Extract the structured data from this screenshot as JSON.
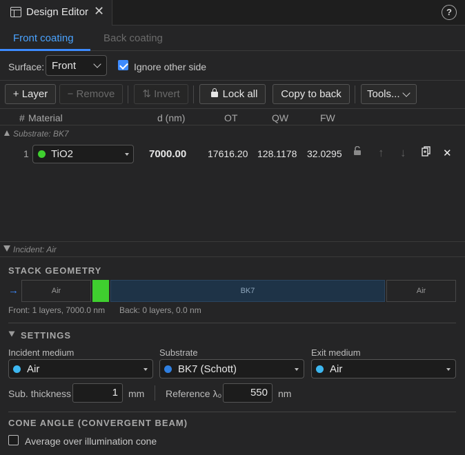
{
  "window": {
    "tab_title": "Design Editor",
    "help_label": "?"
  },
  "coating_tabs": [
    {
      "label": "Front coating"
    },
    {
      "label": "Back coating"
    }
  ],
  "surface": {
    "label": "Surface:",
    "value": "Front",
    "ignore_other_side": {
      "label": "Ignore other side",
      "checked": true
    }
  },
  "toolbar": {
    "add_layer": "+ Layer",
    "remove": "− Remove",
    "invert": "⇅ Invert",
    "lock_all": "Lock all",
    "copy_to_back": "Copy to back",
    "tools": "Tools..."
  },
  "table": {
    "headers": {
      "num": "#",
      "material": "Material",
      "d": "d (nm)",
      "ot": "OT",
      "qw": "QW",
      "fw": "FW"
    },
    "substrate_label": "Substrate: BK7",
    "incident_label": "Incident: Air",
    "rows": [
      {
        "num": "1",
        "material": "TiO2",
        "material_color": "#3fcf2f",
        "d": "7000.00",
        "ot": "17616.20",
        "qw": "128.1178",
        "fw": "32.0295"
      }
    ]
  },
  "stack_geometry": {
    "title": "STACK GEOMETRY",
    "segments": {
      "left_medium": "Air",
      "substrate": "BK7",
      "right_medium": "Air"
    },
    "layer_color": "#3fcf2f",
    "front_info": "Front: 1 layers, 7000.0 nm",
    "back_info": "Back: 0 layers, 0.0 nm"
  },
  "settings": {
    "title": "SETTINGS",
    "incident_medium": {
      "label": "Incident medium",
      "value": "Air",
      "color": "#3db7f0"
    },
    "substrate": {
      "label": "Substrate",
      "value": "BK7 (Schott)",
      "color": "#2f7fe0"
    },
    "exit_medium": {
      "label": "Exit medium",
      "value": "Air",
      "color": "#3db7f0"
    },
    "sub_thickness": {
      "label": "Sub. thickness",
      "value": "1",
      "unit": "mm"
    },
    "reference": {
      "label": "Reference λ₀",
      "value": "550",
      "unit": "nm"
    }
  },
  "cone_angle": {
    "title": "CONE ANGLE (CONVERGENT BEAM)",
    "average": {
      "label": "Average over illumination cone",
      "checked": false
    }
  },
  "colors": {
    "accent": "#3d8bff",
    "background": "#252526"
  }
}
